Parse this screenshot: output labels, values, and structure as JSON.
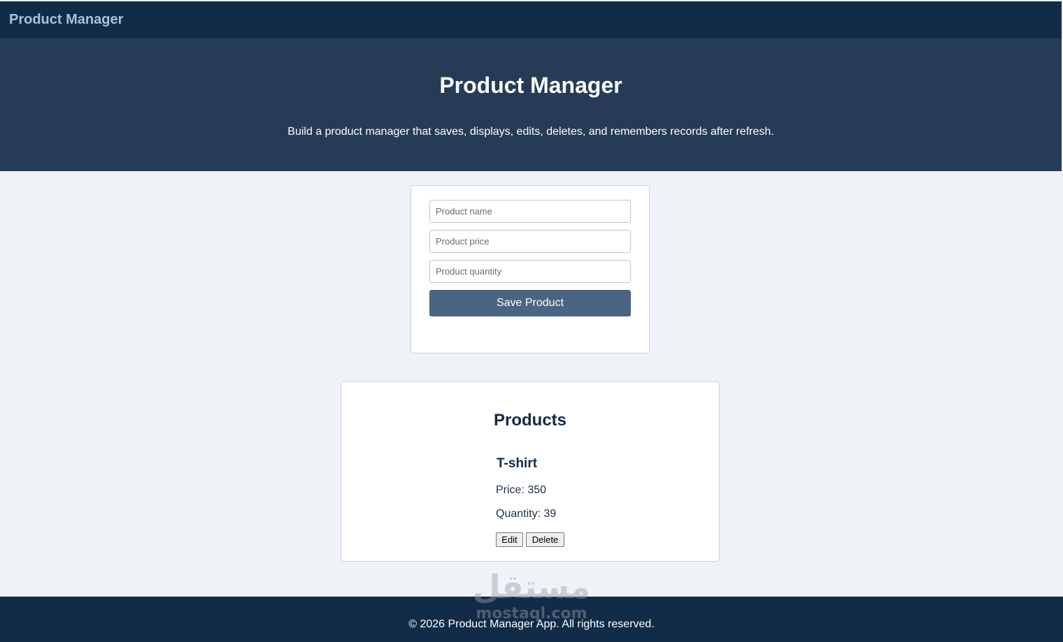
{
  "topbar": {
    "brand": "Product Manager"
  },
  "hero": {
    "title": "Product Manager",
    "subtitle": "Build a product manager that saves, displays, edits, deletes, and remembers records after refresh."
  },
  "form": {
    "name_placeholder": "Product name",
    "price_placeholder": "Product price",
    "quantity_placeholder": "Product quantity",
    "save_label": "Save Product"
  },
  "products": {
    "title": "Products",
    "items": [
      {
        "name": "T-shirt",
        "price": "Price: 350",
        "quantity": "Quantity: 39",
        "edit_label": "Edit",
        "delete_label": "Delete"
      }
    ]
  },
  "footer": {
    "text": "© 2026 Product Manager App. All rights reserved."
  },
  "watermark": {
    "arabic": "مستقل",
    "latin": "mostaql.com"
  },
  "colors": {
    "nav": "#122b47",
    "hero": "#263b55",
    "accent": "#4a6582",
    "background": "#eff3f8"
  }
}
